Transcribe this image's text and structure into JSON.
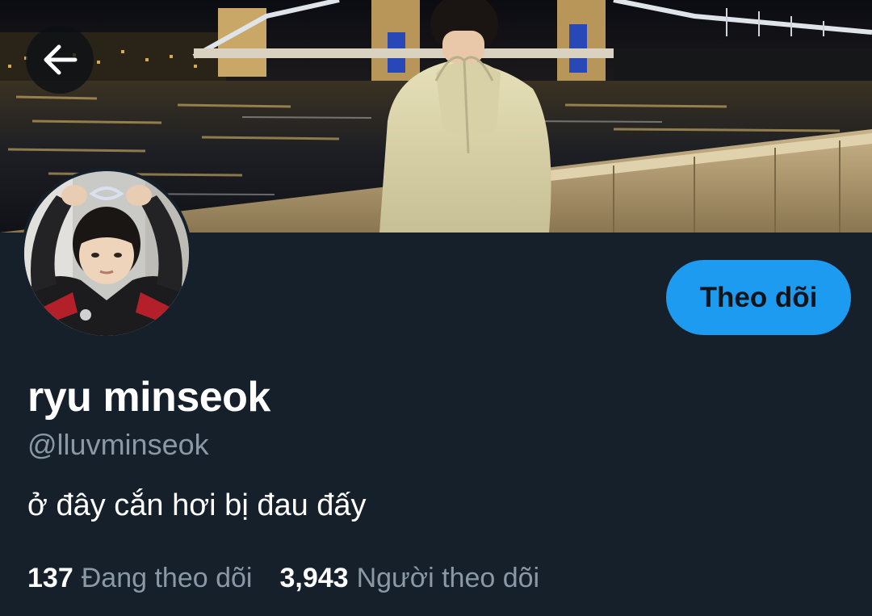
{
  "header": {
    "back_icon": "arrow-left-icon",
    "banner_alt": "banner-photo"
  },
  "profile": {
    "display_name": "ryu minseok",
    "handle": "@lluvminseok",
    "bio": "ở đây cắn hơi bị đau đấy",
    "follow_label": "Theo dõi",
    "following_count": "137",
    "following_label": "Đang theo dõi",
    "followers_count": "3,943",
    "followers_label": "Người theo dõi"
  },
  "colors": {
    "background": "#15202b",
    "accent": "#1d9bf0",
    "primary_text": "#ffffff",
    "secondary_text": "#8b98a5"
  }
}
